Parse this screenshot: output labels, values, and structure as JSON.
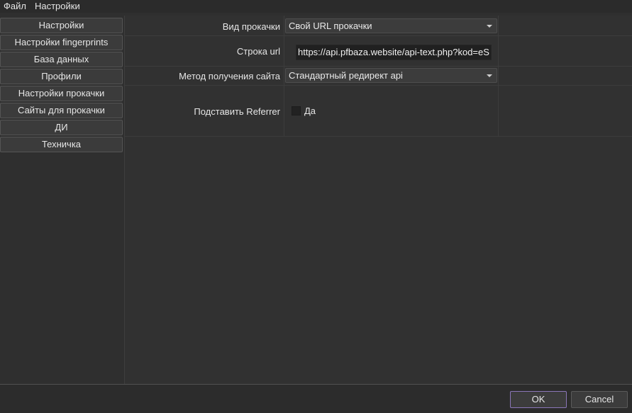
{
  "menu": [
    "Файл",
    "Настройки"
  ],
  "sidebar": {
    "items": [
      "Настройки",
      "Настройки fingerprints",
      "База данных",
      "Профили",
      "Настройки прокачки",
      "Сайты для прокачки",
      "ДИ",
      "Техничка"
    ]
  },
  "form": {
    "type_label": "Вид прокачки",
    "type_value": "Свой URL прокачки",
    "url_label": "Строка url",
    "url_value": "https://api.pfbaza.website/api-text.php?kod=eS",
    "method_label": "Метод получения сайта",
    "method_value": "Стандартный редирект api",
    "referrer_label": "Подставить Referrer",
    "referrer_checkbox_label": "Да",
    "referrer_checked": false
  },
  "footer": {
    "ok_label": "OK",
    "cancel_label": "Cancel"
  },
  "colors": {
    "accent": "#8a76b8",
    "background": "#2f2f2f"
  }
}
